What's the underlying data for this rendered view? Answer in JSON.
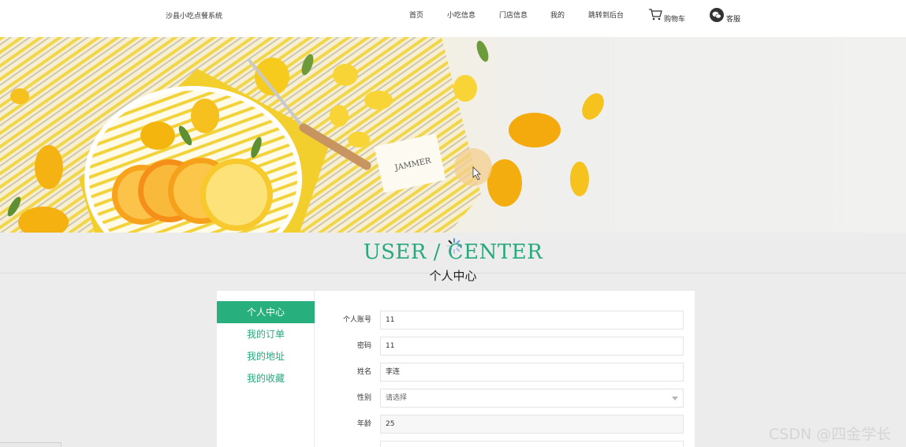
{
  "header": {
    "brand": "沙县小吃点餐系统",
    "nav": [
      {
        "label": "首页"
      },
      {
        "label": "小吃信息"
      },
      {
        "label": "门店信息"
      },
      {
        "label": "我的"
      },
      {
        "label": "跳转到后台"
      },
      {
        "label": "购物车"
      },
      {
        "label": "客服"
      }
    ]
  },
  "section": {
    "title_en": "USER / CENTER",
    "title_cn": "个人中心"
  },
  "sidebar": {
    "items": [
      {
        "label": "个人中心",
        "active": true
      },
      {
        "label": "我的订单"
      },
      {
        "label": "我的地址"
      },
      {
        "label": "我的收藏"
      }
    ]
  },
  "form": {
    "fields": [
      {
        "label": "个人账号",
        "value": "11"
      },
      {
        "label": "密码",
        "value": "11"
      },
      {
        "label": "姓名",
        "value": "李连"
      },
      {
        "label": "性别",
        "placeholder": "请选择"
      },
      {
        "label": "年龄",
        "value": "25"
      }
    ]
  },
  "watermark": "CSDN @四金学长",
  "colors": {
    "accent": "#27b07e",
    "accent_text": "#27a97d"
  }
}
